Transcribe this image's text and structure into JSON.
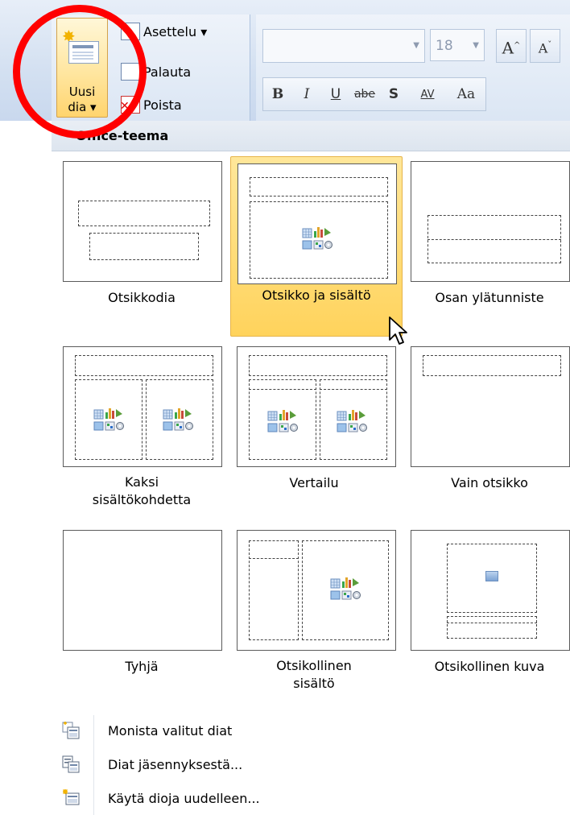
{
  "ribbon": {
    "new_slide": {
      "line1": "Uusi",
      "line2": "dia ▾"
    },
    "layout_label": "Asettelu ▾",
    "reset_label": "Palauta",
    "delete_label": "Poista",
    "font_size": "18",
    "grow_font": "A",
    "shrink_font": "A",
    "bold": "B",
    "italic": "I",
    "underline": "U",
    "strikethrough": "abe",
    "shadow": "S",
    "spacing": "AV",
    "case": "Aa"
  },
  "gallery": {
    "header": "Office-teema",
    "layouts": [
      {
        "label": "Otsikkodia"
      },
      {
        "label": "Otsikko ja sisältö"
      },
      {
        "label": "Osan ylätunniste"
      },
      {
        "label_line1": "Kaksi",
        "label_line2": "sisältökohdetta"
      },
      {
        "label": "Vertailu"
      },
      {
        "label": "Vain otsikko"
      },
      {
        "label": "Tyhjä"
      },
      {
        "label_line1": "Otsikollinen",
        "label_line2": "sisältö"
      },
      {
        "label": "Otsikollinen kuva"
      }
    ],
    "selected_index": 1
  },
  "menu": {
    "items": [
      {
        "label": "Monista valitut diat",
        "icon": "duplicate-slides-icon"
      },
      {
        "label": "Diat jäsennyksestä...",
        "icon": "slides-from-outline-icon"
      },
      {
        "label": "Käytä dioja uudelleen...",
        "icon": "reuse-slides-icon"
      }
    ]
  },
  "colors": {
    "highlight": "#ffd35c",
    "annotation_ring": "#ff0000"
  }
}
